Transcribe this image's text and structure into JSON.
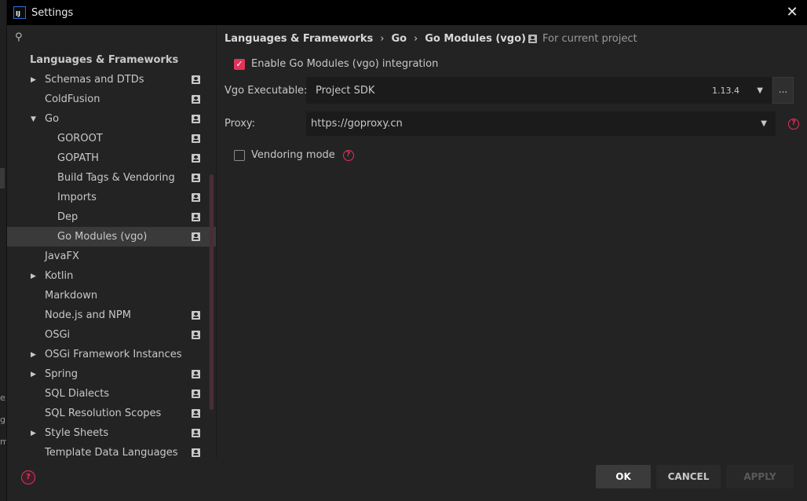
{
  "window": {
    "title": "Settings",
    "logo_text": "IJ",
    "close_glyph": "✕"
  },
  "background": {
    "left_letters": [
      "e,",
      "gl",
      "m"
    ]
  },
  "search": {
    "icon": "search-icon",
    "glyph": "⚲",
    "value": ""
  },
  "sidebar": {
    "header": "Languages & Frameworks",
    "items": [
      {
        "label": "Schemas and DTDs",
        "arrow": "▶",
        "project": true
      },
      {
        "label": "ColdFusion",
        "arrow": "",
        "project": true
      },
      {
        "label": "Go",
        "arrow": "▼",
        "project": true
      },
      {
        "label": "GOROOT",
        "arrow": "",
        "project": true
      },
      {
        "label": "GOPATH",
        "arrow": "",
        "project": true
      },
      {
        "label": "Build Tags & Vendoring",
        "arrow": "",
        "project": true
      },
      {
        "label": "Imports",
        "arrow": "",
        "project": true
      },
      {
        "label": "Dep",
        "arrow": "",
        "project": true
      },
      {
        "label": "Go Modules (vgo)",
        "arrow": "",
        "project": true
      },
      {
        "label": "JavaFX",
        "arrow": "",
        "project": false
      },
      {
        "label": "Kotlin",
        "arrow": "▶",
        "project": false
      },
      {
        "label": "Markdown",
        "arrow": "",
        "project": false
      },
      {
        "label": "Node.js and NPM",
        "arrow": "",
        "project": true
      },
      {
        "label": "OSGi",
        "arrow": "",
        "project": true
      },
      {
        "label": "OSGi Framework Instances",
        "arrow": "▶",
        "project": false
      },
      {
        "label": "Spring",
        "arrow": "▶",
        "project": true
      },
      {
        "label": "SQL Dialects",
        "arrow": "",
        "project": true
      },
      {
        "label": "SQL Resolution Scopes",
        "arrow": "",
        "project": true
      },
      {
        "label": "Style Sheets",
        "arrow": "▶",
        "project": true
      },
      {
        "label": "Template Data Languages",
        "arrow": "",
        "project": true
      }
    ],
    "selected": "Go Modules (vgo)"
  },
  "breadcrumb": {
    "items": [
      "Languages & Frameworks",
      "Go",
      "Go Modules (vgo)"
    ],
    "separator": "›",
    "scope_label": "For current project"
  },
  "settings": {
    "enable_label": "Enable Go Modules (vgo) integration",
    "enable_checked": true,
    "check_glyph": "✓",
    "vgo_label": "Vgo Executable:",
    "vgo_value": "Project SDK",
    "vgo_version": "1.13.4",
    "dots_label": "...",
    "proxy_label": "Proxy:",
    "proxy_value": "https://goproxy.cn",
    "vendoring_label": "Vendoring mode",
    "vendoring_checked": false,
    "caret": "▼",
    "help_glyph": "?"
  },
  "footer": {
    "help_glyph": "?",
    "ok": "OK",
    "cancel": "CANCEL",
    "apply": "APPLY"
  },
  "colors": {
    "accent": "#e2335b",
    "background": "#232323",
    "titlebar": "#000000",
    "selected_row": "#3a3a3a"
  }
}
